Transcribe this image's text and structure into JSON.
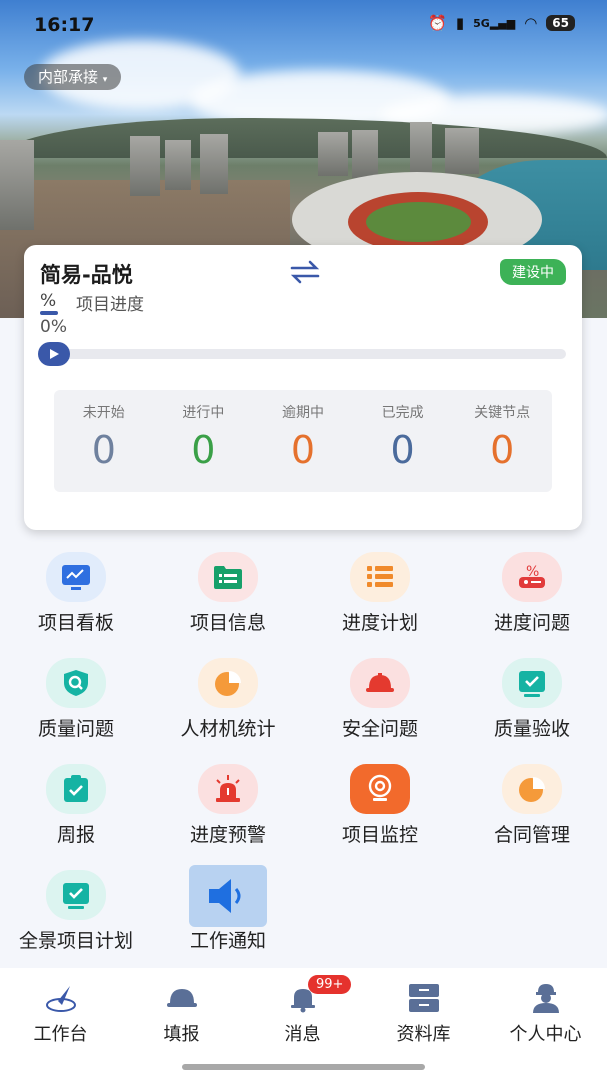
{
  "status_bar": {
    "time": "16:17",
    "battery": "65",
    "network": "5G"
  },
  "org_selector": {
    "label": "内部承接",
    "arrow": "▾"
  },
  "project": {
    "name": "简易-品悦",
    "status": "建设中",
    "percent_symbol": "%",
    "progress_label": "项目进度",
    "progress_value": "0%",
    "progress_fraction": 0
  },
  "stats": [
    {
      "label": "未开始",
      "value": "0",
      "color": "#6f819e"
    },
    {
      "label": "进行中",
      "value": "0",
      "color": "#3aa047"
    },
    {
      "label": "逾期中",
      "value": "0",
      "color": "#e5712d"
    },
    {
      "label": "已完成",
      "value": "0",
      "color": "#4b6b9c"
    },
    {
      "label": "关键节点",
      "value": "0",
      "color": "#e5712d"
    }
  ],
  "menu": [
    {
      "label": "项目看板",
      "icon": "monitor-chart-icon"
    },
    {
      "label": "项目信息",
      "icon": "folder-list-icon"
    },
    {
      "label": "进度计划",
      "icon": "list-icon"
    },
    {
      "label": "进度问题",
      "icon": "progress-issue-icon"
    },
    {
      "label": "质量问题",
      "icon": "shield-search-icon"
    },
    {
      "label": "人材机统计",
      "icon": "pie-chart-icon"
    },
    {
      "label": "安全问题",
      "icon": "hard-hat-icon"
    },
    {
      "label": "质量验收",
      "icon": "check-screen-icon"
    },
    {
      "label": "周报",
      "icon": "clipboard-check-icon"
    },
    {
      "label": "进度预警",
      "icon": "alarm-light-icon"
    },
    {
      "label": "项目监控",
      "icon": "camera-icon"
    },
    {
      "label": "合同管理",
      "icon": "pie-chart-icon"
    },
    {
      "label": "全景项目计划",
      "icon": "check-screen-icon"
    },
    {
      "label": "工作通知",
      "icon": "speaker-icon"
    }
  ],
  "nav": [
    {
      "label": "工作台",
      "icon": "compass-icon"
    },
    {
      "label": "填报",
      "icon": "hard-hat-icon"
    },
    {
      "label": "消息",
      "icon": "bell-icon",
      "badge": "99+"
    },
    {
      "label": "资料库",
      "icon": "database-icon"
    },
    {
      "label": "个人中心",
      "icon": "user-icon"
    }
  ],
  "colors": {
    "brand": "#3a58a9",
    "status_green": "#3db257",
    "badge_red": "#e5322d"
  }
}
